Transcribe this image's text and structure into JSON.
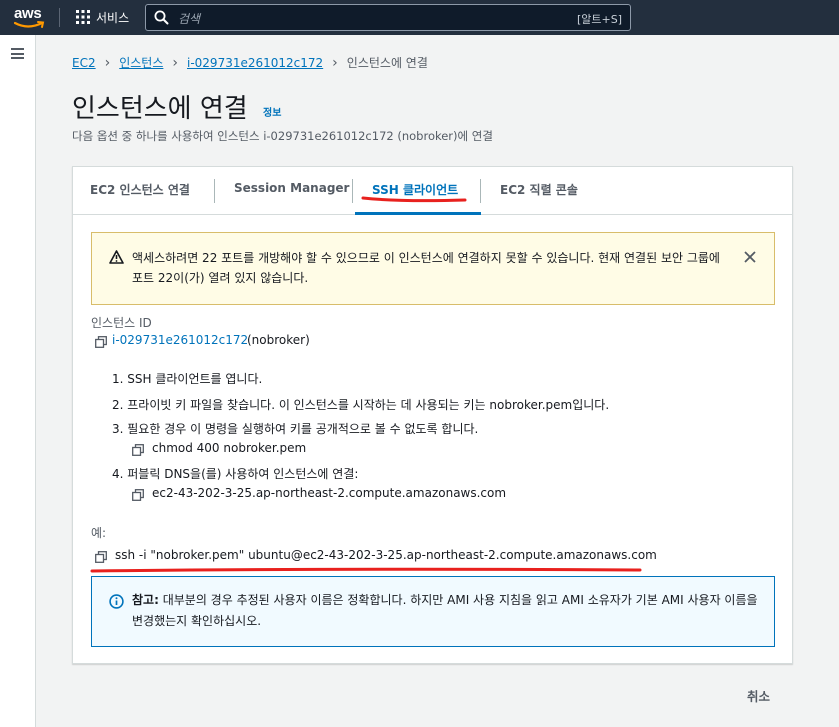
{
  "topnav": {
    "logo": "aws",
    "services_label": "서비스",
    "search_placeholder": "검색",
    "search_shortcut": "[알트+S]"
  },
  "breadcrumb": {
    "items": [
      "EC2",
      "인스턴스",
      "i-029731e261012c172"
    ],
    "current": "인스턴스에 연결"
  },
  "page": {
    "title": "인스턴스에 연결",
    "info": "정보",
    "subtitle": "다음 옵션 중 하나를 사용하여 인스턴스 i-029731e261012c172 (nobroker)에 연결"
  },
  "tabs": [
    {
      "label": "EC2 인스턴스 연결",
      "active": false
    },
    {
      "label": "Session Manager",
      "active": false
    },
    {
      "label": "SSH 클라이언트",
      "active": true
    },
    {
      "label": "EC2 직렬 콘솔",
      "active": false
    }
  ],
  "warning": {
    "text": "액세스하려면 22 포트를 개방해야 할 수 있으므로 이 인스턴스에 연결하지 못할 수 있습니다. 현재 연결된 보안 그룹에 포트 22이(가) 열려 있지 않습니다."
  },
  "instance": {
    "label": "인스턴스 ID",
    "id": "i-029731e261012c172",
    "name": "(nobroker)"
  },
  "steps": {
    "s1": "1. SSH 클라이언트를 엽니다.",
    "s2": "2. 프라이빗 키 파일을 찾습니다. 이 인스턴스를 시작하는 데 사용되는 키는 nobroker.pem입니다.",
    "s3": "3. 필요한 경우 이 명령을 실행하여 키를 공개적으로 볼 수 없도록 합니다.",
    "s3_cmd": "chmod 400 nobroker.pem",
    "s4": "4. 퍼블릭 DNS을(를) 사용하여 인스턴스에 연결:",
    "s4_dns": "ec2-43-202-3-25.ap-northeast-2.compute.amazonaws.com"
  },
  "example": {
    "label": "예:",
    "command": "ssh -i \"nobroker.pem\" ubuntu@ec2-43-202-3-25.ap-northeast-2.compute.amazonaws.com"
  },
  "note": {
    "bold": "참고:",
    "text": " 대부분의 경우 추정된 사용자 이름은 정확합니다. 하지만 AMI 사용 지침을 읽고 AMI 소유자가 기본 AMI 사용자 이름을 변경했는지 확인하십시오."
  },
  "footer": {
    "cancel": "취소"
  },
  "colors": {
    "nav_bg": "#232f3e",
    "link": "#0073bb",
    "warn_bg": "#fffce6",
    "warn_border": "#d8bd6a",
    "info_bg": "#f1faff",
    "annotation_red": "#e8211e"
  }
}
